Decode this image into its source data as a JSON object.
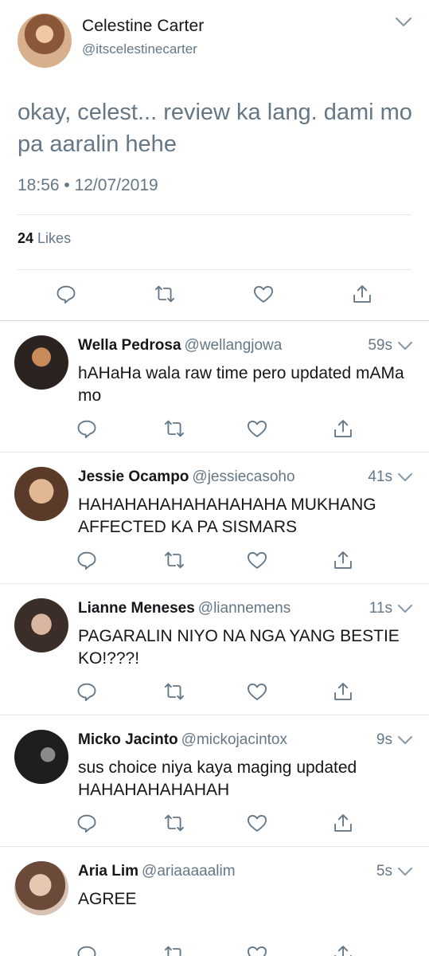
{
  "tweet": {
    "author_name": "Celestine Carter",
    "author_handle": "@itscelestinecarter",
    "text": "okay, celest... review ka lang. dami mo pa aaralin hehe",
    "timestamp": "18:56 • 12/07/2019",
    "likes_count": "24",
    "likes_label": "Likes"
  },
  "replies": [
    {
      "name": "Wella Pedrosa",
      "handle": "@wellangjowa",
      "time": "59s",
      "text": "hAHaHa wala raw time pero updated mAMa mo",
      "avatar_colors": [
        "#2b2320",
        "#c98b5a"
      ]
    },
    {
      "name": "Jessie Ocampo",
      "handle": "@jessiecasoho",
      "time": "41s",
      "text": "HAHAHAHAHAHAHAHAHA MUKHANG AFFECTED KA PA SISMARS",
      "avatar_colors": [
        "#5a3a28",
        "#e2b894"
      ]
    },
    {
      "name": "Lianne Meneses",
      "handle": "@liannemens",
      "time": "11s",
      "text": "PAGARALIN NIYO NA NGA YANG BESTIE KO!???!",
      "avatar_colors": [
        "#3b2d28",
        "#d9b6a0"
      ]
    },
    {
      "name": "Micko Jacinto",
      "handle": "@mickojacintox",
      "time": "9s",
      "text": "sus choice niya kaya maging updated HAHAHAHAHAHAH",
      "avatar_colors": [
        "#1e1e1e",
        "#8a8a8a"
      ]
    },
    {
      "name": "Aria Lim",
      "handle": "@ariaaaaalim",
      "time": "5s",
      "text": "AGREE",
      "avatar_colors": [
        "#6b4a3a",
        "#e6c7b0"
      ]
    }
  ],
  "icons": {
    "reply": "reply-icon",
    "retweet": "retweet-icon",
    "like": "like-icon",
    "share": "share-icon",
    "caret": "chevron-down-icon"
  },
  "colors": {
    "text_primary": "#14171a",
    "text_secondary": "#657786",
    "divider": "#e1e8ed"
  }
}
